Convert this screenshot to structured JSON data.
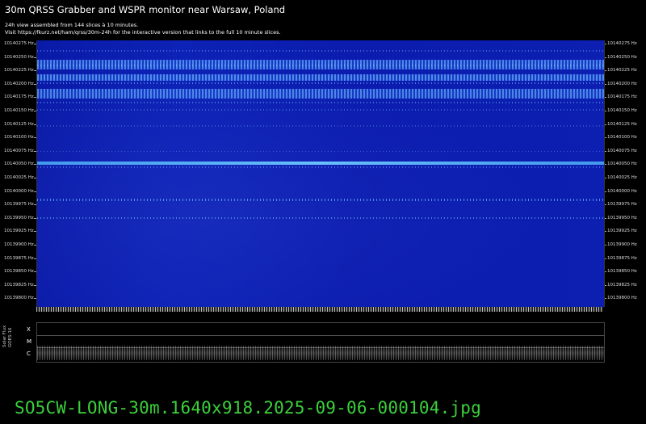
{
  "header": {
    "title": "30m QRSS Grabber and WSPR monitor near Warsaw, Poland",
    "line1": "24h view assembled from 144 slices à 10 minutes.",
    "line2": "Visit https://fkurz.net/ham/qrss/30m-24h for the interactive version that links to the full 10 minute slices."
  },
  "frequency_labels": [
    "10140275 Hz",
    "10140250 Hz",
    "10140225 Hz",
    "10140200 Hz",
    "10140175 Hz",
    "10140150 Hz",
    "10140125 Hz",
    "10140100 Hz",
    "10140075 Hz",
    "10140050 Hz",
    "10140025 Hz",
    "10140000 Hz",
    "10139975 Hz",
    "10139950 Hz",
    "10139925 Hz",
    "10139900 Hz",
    "10139875 Hz",
    "10139850 Hz",
    "10139825 Hz",
    "10139800 Hz"
  ],
  "xray": {
    "side_label_1": "Solar Flux",
    "side_label_2": "GOES-16",
    "classes": [
      "X",
      "M",
      "C"
    ]
  },
  "footer": {
    "filename": "SO5CW-LONG-30m.1640x918.2025-09-06-000104.jpg"
  },
  "colors": {
    "background": "#000000",
    "spectrogram_base": "#0d22b6",
    "signal": "#6eb4ff",
    "filename": "#3bd13b"
  }
}
